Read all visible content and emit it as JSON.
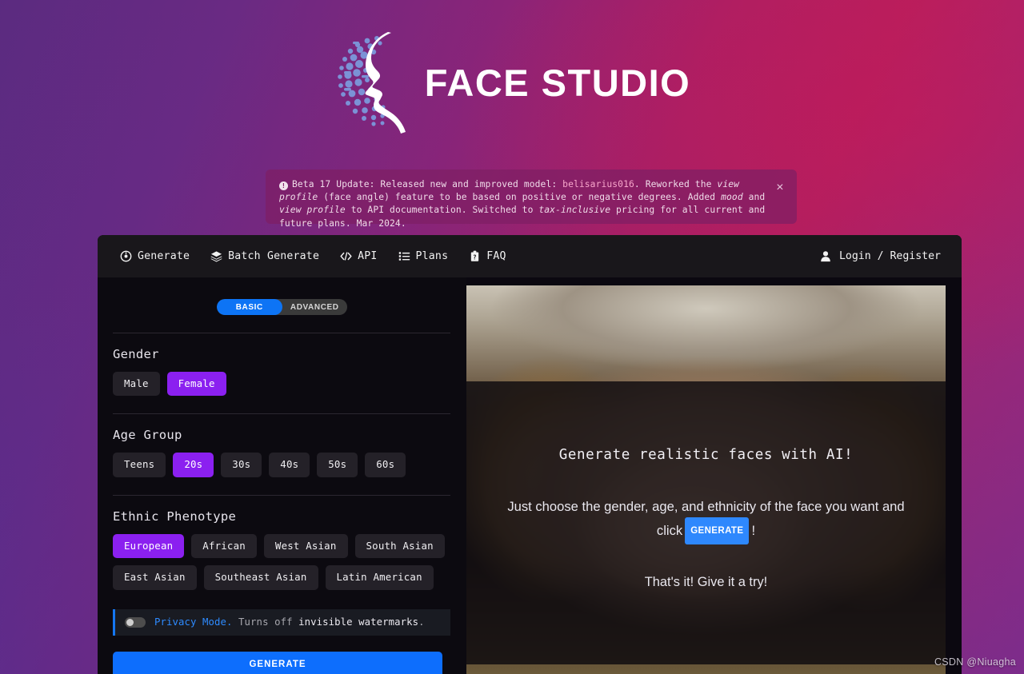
{
  "brand": {
    "name": "FACE STUDIO",
    "logo_icon": "dotted-sphere-face-profile-logo"
  },
  "banner": {
    "info_icon": "!",
    "close_icon": "×",
    "segments": [
      {
        "text": "Beta 17 Update: Released new and improved model: ",
        "style": "normal"
      },
      {
        "text": "belisarius016",
        "style": "model"
      },
      {
        "text": ". Reworked the ",
        "style": "normal"
      },
      {
        "text": "view profile",
        "style": "italic"
      },
      {
        "text": " (face angle) feature to be based on positive or negative degrees. Added ",
        "style": "normal"
      },
      {
        "text": "mood",
        "style": "italic"
      },
      {
        "text": " and ",
        "style": "normal"
      },
      {
        "text": "view profile",
        "style": "italic"
      },
      {
        "text": " to API documentation. Switched to ",
        "style": "normal"
      },
      {
        "text": "tax-inclusive",
        "style": "italic"
      },
      {
        "text": " pricing for all current and future plans. Mar 2024.",
        "style": "normal"
      }
    ]
  },
  "nav": {
    "items": [
      {
        "label": "Generate",
        "icon": "target-eye-icon"
      },
      {
        "label": "Batch Generate",
        "icon": "layers-icon"
      },
      {
        "label": "API",
        "icon": "code-brackets-icon"
      },
      {
        "label": "Plans",
        "icon": "list-icon"
      },
      {
        "label": "FAQ",
        "icon": "question-badge-icon"
      }
    ],
    "account": {
      "label": "Login / Register",
      "icon": "user-icon"
    }
  },
  "mode_tabs": {
    "options": [
      "BASIC",
      "ADVANCED"
    ],
    "selected": "BASIC"
  },
  "form": {
    "gender": {
      "label": "Gender",
      "options": [
        "Male",
        "Female"
      ],
      "selected": "Female"
    },
    "age_group": {
      "label": "Age Group",
      "options": [
        "Teens",
        "20s",
        "30s",
        "40s",
        "50s",
        "60s"
      ],
      "selected": "20s"
    },
    "ethnic_phenotype": {
      "label": "Ethnic Phenotype",
      "options": [
        "European",
        "African",
        "West Asian",
        "South Asian",
        "East Asian",
        "Southeast Asian",
        "Latin American"
      ],
      "selected": "European"
    },
    "privacy_mode": {
      "title": "Privacy Mode.",
      "desc_dim": " Turns off ",
      "desc_bright": "invisible watermarks",
      "desc_end": ".",
      "enabled": false
    },
    "generate_button": "GENERATE"
  },
  "hero": {
    "headline": "Generate realistic faces with AI!",
    "body_before": "Just choose the gender, age, and ethnicity of the face you want and click",
    "body_kbd": "GENERATE",
    "body_after": "!",
    "footer": "That's it! Give it a try!"
  },
  "watermark": "CSDN @Niuagha",
  "colors": {
    "accent_blue": "#0d6efd",
    "accent_purple": "#8b20f0",
    "panel_bg": "#0c0a10",
    "nav_bg": "#19171b",
    "chip_bg": "#242128"
  }
}
